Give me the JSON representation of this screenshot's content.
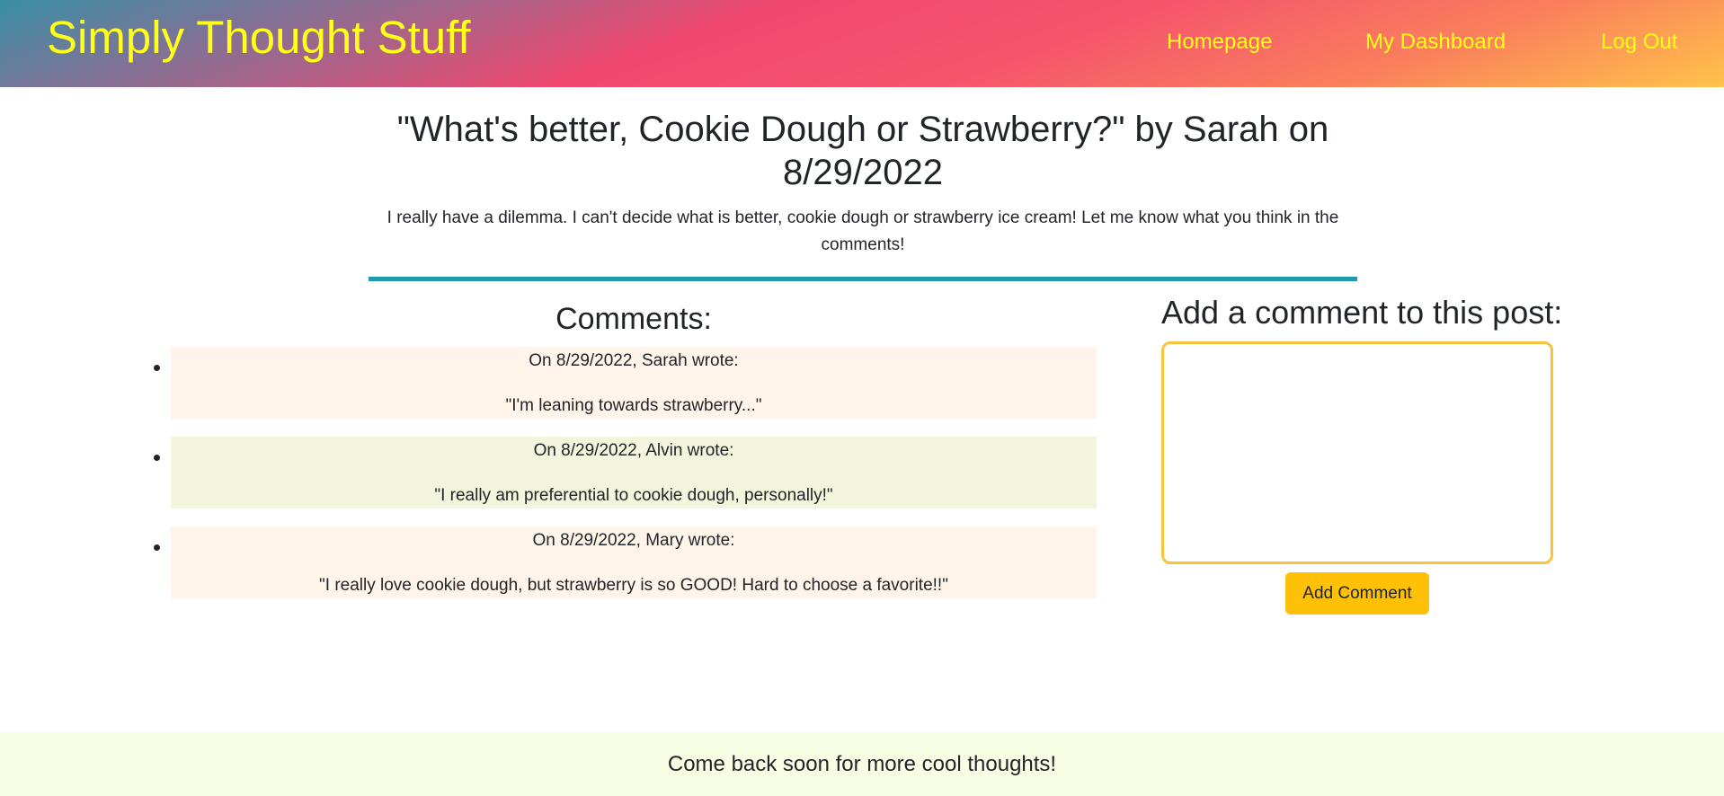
{
  "header": {
    "brand": "Simply Thought Stuff",
    "nav": [
      {
        "label": "Homepage"
      },
      {
        "label": "My Dashboard"
      },
      {
        "label": "Log Out"
      }
    ],
    "text_color": "#ffff1a"
  },
  "post": {
    "title": "\"What's better, Cookie Dough or Strawberry?\" by Sarah on 8/29/2022",
    "body": "I really have a dilemma. I can't decide what is better, cookie dough or strawberry ice cream! Let me know what you think in the comments!",
    "divider_color": "#1f9aa8"
  },
  "comments": {
    "heading": "Comments:",
    "items": [
      {
        "meta": "On 8/29/2022, Sarah wrote:",
        "text": "\"I'm leaning towards strawberry...\"",
        "bg": "#fff4ea"
      },
      {
        "meta": "On 8/29/2022, Alvin wrote:",
        "text": "\"I really am preferential to cookie dough, personally!\"",
        "bg": "#f3f5dd"
      },
      {
        "meta": "On 8/29/2022, Mary wrote:",
        "text": "\"I really love cookie dough, but strawberry is so GOOD! Hard to choose a favorite!!\"",
        "bg": "#fff4ea"
      }
    ]
  },
  "add_comment": {
    "heading": "Add a comment to this post:",
    "textarea_value": "",
    "button_label": "Add Comment",
    "border_color": "#f9c33b",
    "button_color": "#fec107"
  },
  "footer": {
    "text": "Come back soon for more cool thoughts!",
    "bg": "#f8fee4"
  }
}
